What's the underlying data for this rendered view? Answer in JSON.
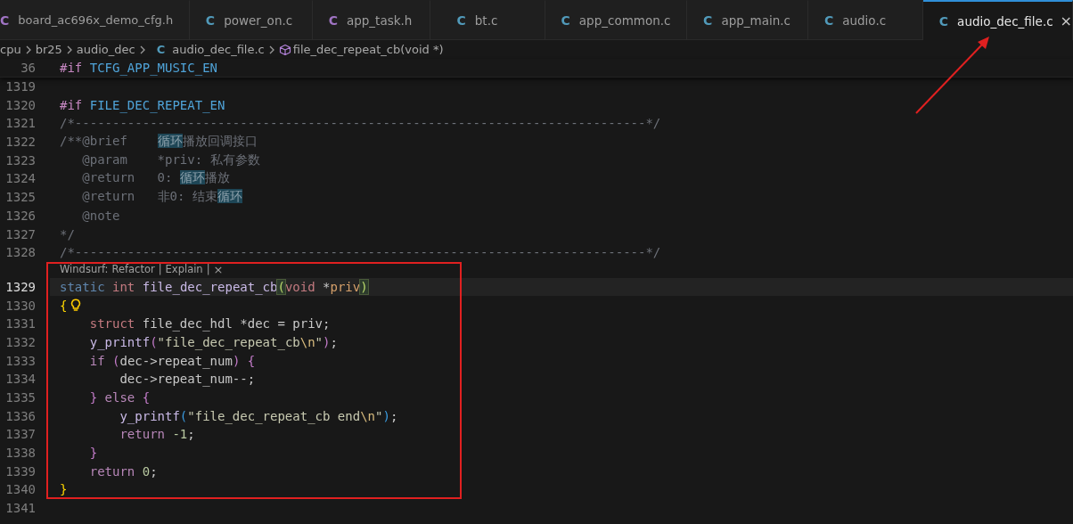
{
  "tabs": [
    {
      "icon": "C",
      "color": "#a074c4",
      "label": "board_ac696x_demo_cfg.h",
      "selected": false
    },
    {
      "icon": "C",
      "color": "#519aba",
      "label": "power_on.c",
      "selected": false
    },
    {
      "icon": "C",
      "color": "#a074c4",
      "label": "app_task.h",
      "selected": false
    },
    {
      "icon": "C",
      "color": "#519aba",
      "label": "bt.c",
      "selected": false
    },
    {
      "icon": "C",
      "color": "#519aba",
      "label": "app_common.c",
      "selected": false
    },
    {
      "icon": "C",
      "color": "#519aba",
      "label": "app_main.c",
      "selected": false
    },
    {
      "icon": "C",
      "color": "#519aba",
      "label": "audio.c",
      "selected": false
    },
    {
      "icon": "C",
      "color": "#519aba",
      "label": "audio_dec_file.c",
      "selected": true,
      "close": "×"
    }
  ],
  "breadcrumb": [
    {
      "kind": "folder",
      "label": "cpu"
    },
    {
      "kind": "folder",
      "label": "br25"
    },
    {
      "kind": "folder",
      "label": "audio_dec"
    },
    {
      "kind": "file",
      "icon": "C",
      "label": "audio_dec_file.c"
    },
    {
      "kind": "symbol",
      "label": "file_dec_repeat_cb(void *)"
    }
  ],
  "sticky_line": {
    "number": "36",
    "tokens": [
      {
        "kind": "preproc",
        "text": "#if "
      },
      {
        "kind": "macro",
        "text": "TCFG_APP_MUSIC_EN"
      }
    ]
  },
  "lines": [
    {
      "kind": "code",
      "number": "1319",
      "current": false
    },
    {
      "kind": "code",
      "number": "1320",
      "current": false,
      "tokens": [
        {
          "kind": "preproc",
          "text": "#if "
        },
        {
          "kind": "macro",
          "text": "FILE_DEC_REPEAT_EN"
        }
      ]
    },
    {
      "kind": "code",
      "number": "1321",
      "current": false,
      "tokens": [
        {
          "kind": "comment",
          "text": "/*----------------------------------------------------------------------------*/"
        }
      ]
    },
    {
      "kind": "code",
      "number": "1322",
      "current": false,
      "tokens": [
        {
          "kind": "comment",
          "text": "/**@brief    "
        },
        {
          "kind": "match",
          "text": "循环"
        },
        {
          "kind": "comment",
          "text": "播放回调接口"
        }
      ]
    },
    {
      "kind": "code",
      "number": "1323",
      "current": false,
      "tokens": [
        {
          "kind": "comment",
          "text": "   @param    *priv: 私有参数"
        }
      ]
    },
    {
      "kind": "code",
      "number": "1324",
      "current": false,
      "tokens": [
        {
          "kind": "comment",
          "text": "   @return   0: "
        },
        {
          "kind": "match",
          "text": "循环"
        },
        {
          "kind": "comment",
          "text": "播放"
        }
      ]
    },
    {
      "kind": "code",
      "number": "1325",
      "current": false,
      "tokens": [
        {
          "kind": "comment",
          "text": "   @return   非0: 结束"
        },
        {
          "kind": "match",
          "text": "循环"
        }
      ]
    },
    {
      "kind": "code",
      "number": "1326",
      "current": false,
      "tokens": [
        {
          "kind": "comment",
          "text": "   @note"
        }
      ]
    },
    {
      "kind": "code",
      "number": "1327",
      "current": false,
      "tokens": [
        {
          "kind": "comment",
          "text": "*/"
        }
      ]
    },
    {
      "kind": "code",
      "number": "1328",
      "current": false,
      "tokens": [
        {
          "kind": "comment",
          "text": "/*----------------------------------------------------------------------------*/"
        }
      ]
    },
    {
      "kind": "codelens",
      "prefix": "Windsurf:",
      "actions": [
        "Refactor",
        "Explain"
      ],
      "separator": "|",
      "close": "×"
    },
    {
      "kind": "code",
      "number": "1329",
      "current": true,
      "tokens": [
        {
          "kind": "storage",
          "text": "static "
        },
        {
          "kind": "type",
          "text": "int "
        },
        {
          "kind": "func",
          "text": "file_dec_repeat_cb"
        },
        {
          "kind": "bracket_match",
          "text": "("
        },
        {
          "kind": "type",
          "text": "void "
        },
        {
          "kind": "plain",
          "text": "*"
        },
        {
          "kind": "param",
          "text": "priv"
        },
        {
          "kind": "bracket_match",
          "text": ")"
        }
      ]
    },
    {
      "kind": "code",
      "number": "1330",
      "current": false,
      "lightbulb": true,
      "tokens": [
        {
          "kind": "bracket_gold",
          "text": "{"
        }
      ]
    },
    {
      "kind": "code",
      "number": "1331",
      "current": false,
      "tokens": [
        {
          "kind": "type",
          "text": "    struct"
        },
        {
          "kind": "plain",
          "text": " file_dec_hdl *dec = priv;"
        }
      ]
    },
    {
      "kind": "code",
      "number": "1332",
      "current": false,
      "tokens": [
        {
          "kind": "func",
          "text": "    y_printf"
        },
        {
          "kind": "bracket_purple",
          "text": "("
        },
        {
          "kind": "string",
          "text": "\"file_dec_repeat_cb"
        },
        {
          "kind": "escape",
          "text": "\\n"
        },
        {
          "kind": "string",
          "text": "\""
        },
        {
          "kind": "bracket_purple",
          "text": ")"
        },
        {
          "kind": "plain",
          "text": ";"
        }
      ]
    },
    {
      "kind": "code",
      "number": "1333",
      "current": false,
      "tokens": [
        {
          "kind": "control",
          "text": "    if "
        },
        {
          "kind": "bracket_purple",
          "text": "("
        },
        {
          "kind": "plain",
          "text": "dec->repeat_num"
        },
        {
          "kind": "bracket_purple",
          "text": ") {"
        }
      ]
    },
    {
      "kind": "code",
      "number": "1334",
      "current": false,
      "tokens": [
        {
          "kind": "plain",
          "text": "        dec->repeat_num--;"
        }
      ]
    },
    {
      "kind": "code",
      "number": "1335",
      "current": false,
      "tokens": [
        {
          "kind": "bracket_purple",
          "text": "    } "
        },
        {
          "kind": "control",
          "text": "else "
        },
        {
          "kind": "bracket_purple",
          "text": "{"
        }
      ]
    },
    {
      "kind": "code",
      "number": "1336",
      "current": false,
      "tokens": [
        {
          "kind": "func",
          "text": "        y_printf"
        },
        {
          "kind": "bracket_blue",
          "text": "("
        },
        {
          "kind": "string",
          "text": "\"file_dec_repeat_cb end"
        },
        {
          "kind": "escape",
          "text": "\\n"
        },
        {
          "kind": "string",
          "text": "\""
        },
        {
          "kind": "bracket_blue",
          "text": ")"
        },
        {
          "kind": "plain",
          "text": ";"
        }
      ]
    },
    {
      "kind": "code",
      "number": "1337",
      "current": false,
      "tokens": [
        {
          "kind": "control",
          "text": "        return "
        },
        {
          "kind": "number",
          "text": "-1"
        },
        {
          "kind": "plain",
          "text": ";"
        }
      ]
    },
    {
      "kind": "code",
      "number": "1338",
      "current": false,
      "tokens": [
        {
          "kind": "bracket_purple",
          "text": "    }"
        }
      ]
    },
    {
      "kind": "code",
      "number": "1339",
      "current": false,
      "tokens": [
        {
          "kind": "control",
          "text": "    return "
        },
        {
          "kind": "number",
          "text": "0"
        },
        {
          "kind": "plain",
          "text": ";"
        }
      ]
    },
    {
      "kind": "code",
      "number": "1340",
      "current": false,
      "tokens": [
        {
          "kind": "bracket_gold",
          "text": "}"
        }
      ]
    },
    {
      "kind": "code",
      "number": "1341",
      "current": false
    }
  ],
  "annotations": {
    "box": true,
    "arrow": true
  }
}
